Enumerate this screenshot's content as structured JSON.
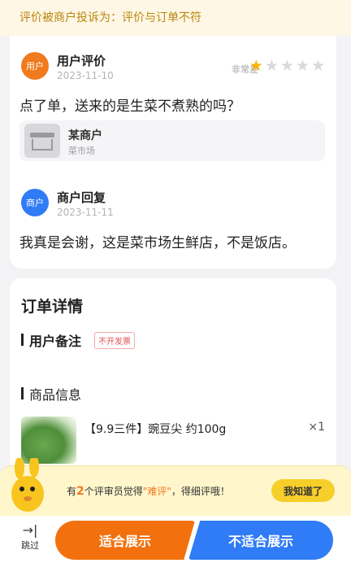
{
  "banner": {
    "text": "评价被商户投诉为：评价与订单不符"
  },
  "review": {
    "user_avatar": "用户",
    "user_name": "用户评价",
    "user_date": "2023-11-10",
    "rating_label": "非常差",
    "rating": 1,
    "rating_max": 5,
    "star_icon": "★",
    "text": "点了单，送来的是生菜不煮熟的吗？",
    "shop_name": "某商户",
    "shop_category": "菜市场",
    "merchant_avatar": "商户",
    "merchant_name": "商户回复",
    "merchant_date": "2023-11-11",
    "reply": "我真是会谢，这是菜市场生鲜店，不是饭店。"
  },
  "order": {
    "title": "订单详情",
    "remark_title": "用户备注",
    "remark_tag": "不开发票",
    "goods_title": "商品信息",
    "product_name": "【9.9三件】豌豆尖 约100g",
    "product_qty": "×1"
  },
  "tip": {
    "prefix": "有",
    "count": "2",
    "middle": "个评审员觉得",
    "highlight": "\"难评\"",
    "suffix": "，得细评哦！",
    "button": "我知道了"
  },
  "actions": {
    "skip_icon": "→|",
    "skip_label": "跳过",
    "suitable": "适合展示",
    "unsuitable": "不适合展示"
  },
  "colors": {
    "orange": "#f2710e",
    "blue": "#2f7cf6",
    "star": "#f7b500",
    "tip_bg": "#fff6cc"
  }
}
